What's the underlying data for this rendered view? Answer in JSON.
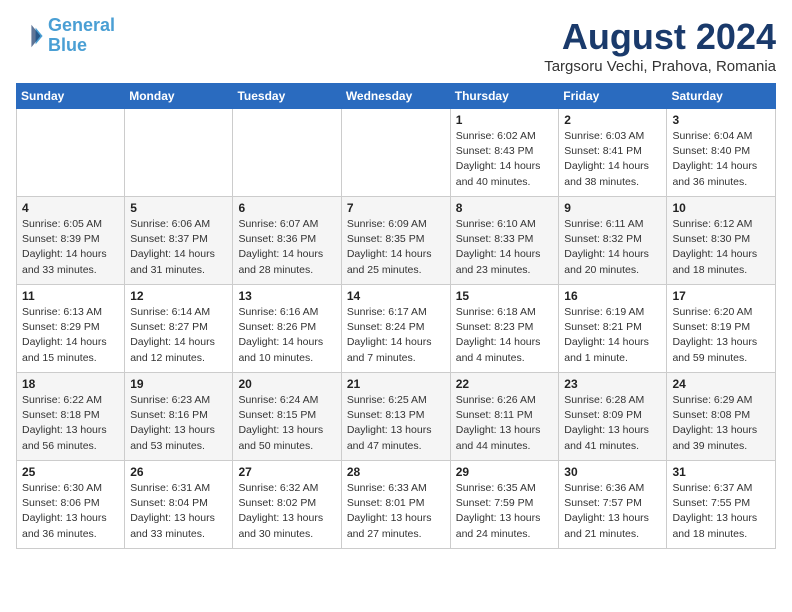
{
  "header": {
    "logo_line1": "General",
    "logo_line2": "Blue",
    "month_year": "August 2024",
    "location": "Targsoru Vechi, Prahova, Romania"
  },
  "weekdays": [
    "Sunday",
    "Monday",
    "Tuesday",
    "Wednesday",
    "Thursday",
    "Friday",
    "Saturday"
  ],
  "weeks": [
    [
      {
        "day": "",
        "info": ""
      },
      {
        "day": "",
        "info": ""
      },
      {
        "day": "",
        "info": ""
      },
      {
        "day": "",
        "info": ""
      },
      {
        "day": "1",
        "info": "Sunrise: 6:02 AM\nSunset: 8:43 PM\nDaylight: 14 hours\nand 40 minutes."
      },
      {
        "day": "2",
        "info": "Sunrise: 6:03 AM\nSunset: 8:41 PM\nDaylight: 14 hours\nand 38 minutes."
      },
      {
        "day": "3",
        "info": "Sunrise: 6:04 AM\nSunset: 8:40 PM\nDaylight: 14 hours\nand 36 minutes."
      }
    ],
    [
      {
        "day": "4",
        "info": "Sunrise: 6:05 AM\nSunset: 8:39 PM\nDaylight: 14 hours\nand 33 minutes."
      },
      {
        "day": "5",
        "info": "Sunrise: 6:06 AM\nSunset: 8:37 PM\nDaylight: 14 hours\nand 31 minutes."
      },
      {
        "day": "6",
        "info": "Sunrise: 6:07 AM\nSunset: 8:36 PM\nDaylight: 14 hours\nand 28 minutes."
      },
      {
        "day": "7",
        "info": "Sunrise: 6:09 AM\nSunset: 8:35 PM\nDaylight: 14 hours\nand 25 minutes."
      },
      {
        "day": "8",
        "info": "Sunrise: 6:10 AM\nSunset: 8:33 PM\nDaylight: 14 hours\nand 23 minutes."
      },
      {
        "day": "9",
        "info": "Sunrise: 6:11 AM\nSunset: 8:32 PM\nDaylight: 14 hours\nand 20 minutes."
      },
      {
        "day": "10",
        "info": "Sunrise: 6:12 AM\nSunset: 8:30 PM\nDaylight: 14 hours\nand 18 minutes."
      }
    ],
    [
      {
        "day": "11",
        "info": "Sunrise: 6:13 AM\nSunset: 8:29 PM\nDaylight: 14 hours\nand 15 minutes."
      },
      {
        "day": "12",
        "info": "Sunrise: 6:14 AM\nSunset: 8:27 PM\nDaylight: 14 hours\nand 12 minutes."
      },
      {
        "day": "13",
        "info": "Sunrise: 6:16 AM\nSunset: 8:26 PM\nDaylight: 14 hours\nand 10 minutes."
      },
      {
        "day": "14",
        "info": "Sunrise: 6:17 AM\nSunset: 8:24 PM\nDaylight: 14 hours\nand 7 minutes."
      },
      {
        "day": "15",
        "info": "Sunrise: 6:18 AM\nSunset: 8:23 PM\nDaylight: 14 hours\nand 4 minutes."
      },
      {
        "day": "16",
        "info": "Sunrise: 6:19 AM\nSunset: 8:21 PM\nDaylight: 14 hours\nand 1 minute."
      },
      {
        "day": "17",
        "info": "Sunrise: 6:20 AM\nSunset: 8:19 PM\nDaylight: 13 hours\nand 59 minutes."
      }
    ],
    [
      {
        "day": "18",
        "info": "Sunrise: 6:22 AM\nSunset: 8:18 PM\nDaylight: 13 hours\nand 56 minutes."
      },
      {
        "day": "19",
        "info": "Sunrise: 6:23 AM\nSunset: 8:16 PM\nDaylight: 13 hours\nand 53 minutes."
      },
      {
        "day": "20",
        "info": "Sunrise: 6:24 AM\nSunset: 8:15 PM\nDaylight: 13 hours\nand 50 minutes."
      },
      {
        "day": "21",
        "info": "Sunrise: 6:25 AM\nSunset: 8:13 PM\nDaylight: 13 hours\nand 47 minutes."
      },
      {
        "day": "22",
        "info": "Sunrise: 6:26 AM\nSunset: 8:11 PM\nDaylight: 13 hours\nand 44 minutes."
      },
      {
        "day": "23",
        "info": "Sunrise: 6:28 AM\nSunset: 8:09 PM\nDaylight: 13 hours\nand 41 minutes."
      },
      {
        "day": "24",
        "info": "Sunrise: 6:29 AM\nSunset: 8:08 PM\nDaylight: 13 hours\nand 39 minutes."
      }
    ],
    [
      {
        "day": "25",
        "info": "Sunrise: 6:30 AM\nSunset: 8:06 PM\nDaylight: 13 hours\nand 36 minutes."
      },
      {
        "day": "26",
        "info": "Sunrise: 6:31 AM\nSunset: 8:04 PM\nDaylight: 13 hours\nand 33 minutes."
      },
      {
        "day": "27",
        "info": "Sunrise: 6:32 AM\nSunset: 8:02 PM\nDaylight: 13 hours\nand 30 minutes."
      },
      {
        "day": "28",
        "info": "Sunrise: 6:33 AM\nSunset: 8:01 PM\nDaylight: 13 hours\nand 27 minutes."
      },
      {
        "day": "29",
        "info": "Sunrise: 6:35 AM\nSunset: 7:59 PM\nDaylight: 13 hours\nand 24 minutes."
      },
      {
        "day": "30",
        "info": "Sunrise: 6:36 AM\nSunset: 7:57 PM\nDaylight: 13 hours\nand 21 minutes."
      },
      {
        "day": "31",
        "info": "Sunrise: 6:37 AM\nSunset: 7:55 PM\nDaylight: 13 hours\nand 18 minutes."
      }
    ]
  ]
}
